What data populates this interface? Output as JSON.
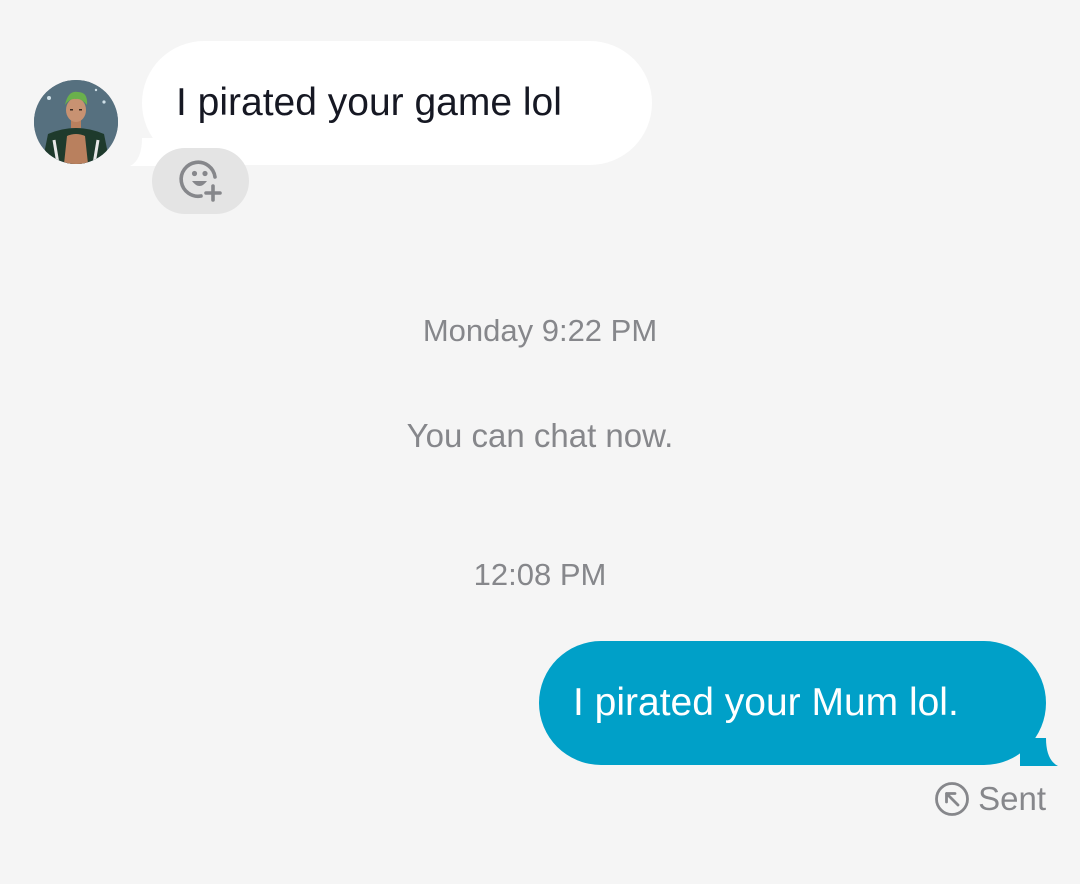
{
  "incoming": {
    "avatar_icon": "character-avatar",
    "text": "I pirated your game lol",
    "reaction_icon": "add-reaction-icon",
    "bubble_color": "#ffffff"
  },
  "timestamp_1": "Monday 9:22 PM",
  "system_message": "You can chat now.",
  "timestamp_2": "12:08 PM",
  "outgoing": {
    "text": "I pirated your Mum lol.",
    "bubble_color": "#00a0c8",
    "status_icon": "sent-arrow-icon",
    "status": "Sent"
  }
}
